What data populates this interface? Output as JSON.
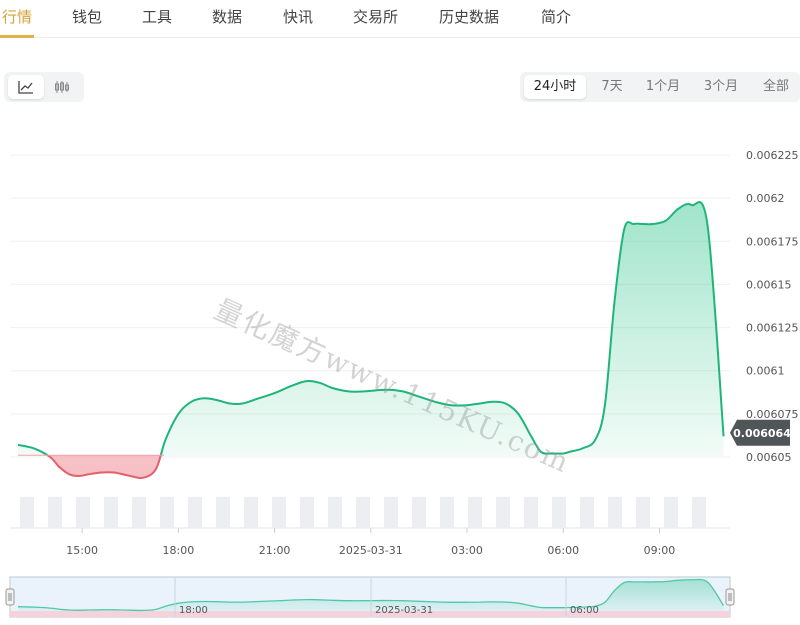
{
  "nav": {
    "tabs": [
      "行情",
      "钱包",
      "工具",
      "数据",
      "快讯",
      "交易所",
      "历史数据",
      "简介"
    ],
    "active_index": 0,
    "active_color": "#d8a23a"
  },
  "view_modes": {
    "items": [
      {
        "icon": "line-chart-icon",
        "active": true
      },
      {
        "icon": "candlestick-icon",
        "active": false
      }
    ]
  },
  "time_ranges": {
    "items": [
      "24小时",
      "7天",
      "1个月",
      "3个月",
      "全部"
    ],
    "active_index": 0
  },
  "watermark": "量化魔方www.115KU.com",
  "chart_data": {
    "type": "area",
    "x_ticks": [
      "15:00",
      "18:00",
      "21:00",
      "2025-03-31",
      "03:00",
      "06:00",
      "09:00"
    ],
    "y_ticks": [
      "0.006225",
      "0.0062",
      "0.006175",
      "0.00615",
      "0.006125",
      "0.0061",
      "0.006075",
      "0.00605"
    ],
    "ylim": [
      0.00605,
      0.006225
    ],
    "baseline": 0.006051,
    "current_price": 0.006064,
    "current_label": "0.006064",
    "x_unit": "hours",
    "x_range": [
      12.75,
      35.2
    ],
    "series": [
      {
        "x": [
          13.0,
          13.5,
          14.0,
          14.3,
          14.6,
          14.9,
          15.2,
          15.6,
          16.0,
          16.5,
          16.9,
          17.3,
          17.6,
          18.0,
          18.4,
          18.8,
          19.2,
          19.6,
          20.0,
          20.5,
          21.0,
          21.5,
          22.0,
          22.4,
          22.8,
          23.3,
          23.8,
          24.5,
          25.0,
          25.5,
          26.0,
          26.5,
          27.0,
          27.4,
          27.8,
          28.2,
          28.6,
          29.0,
          29.3,
          29.6,
          29.8,
          30.0,
          30.2,
          30.6,
          31.0,
          31.3,
          31.6,
          31.9,
          32.2,
          32.5,
          32.8,
          33.2,
          33.6,
          34.0,
          34.5,
          35.0
        ],
        "y": [
          0.006057,
          0.006055,
          0.00605,
          0.006044,
          0.00604,
          0.006039,
          0.00604,
          0.006041,
          0.006041,
          0.006039,
          0.006038,
          0.006043,
          0.00606,
          0.006075,
          0.006082,
          0.006084,
          0.006083,
          0.006081,
          0.006081,
          0.006084,
          0.006087,
          0.006091,
          0.006094,
          0.006093,
          0.00609,
          0.006088,
          0.006088,
          0.006089,
          0.006088,
          0.006085,
          0.006082,
          0.00608,
          0.00608,
          0.006081,
          0.006082,
          0.006081,
          0.006075,
          0.006062,
          0.006053,
          0.006052,
          0.006052,
          0.006052,
          0.006053,
          0.006055,
          0.00606,
          0.00608,
          0.00614,
          0.006182,
          0.006185,
          0.006185,
          0.006185,
          0.006187,
          0.006194,
          0.006196,
          0.006184,
          0.006062
        ]
      }
    ],
    "volume": [
      0.6,
      0.6,
      0.6,
      0.6,
      0.6,
      0.6,
      0.6,
      0.6,
      0.6,
      0.6,
      0.6,
      0.6,
      0.6,
      0.6,
      0.6,
      0.6,
      0.6,
      0.6,
      0.6,
      0.6,
      0.6,
      0.6,
      0.6,
      0.6,
      0.6
    ],
    "up_color": "#1fb57a",
    "down_color": "#e0606c",
    "navigator": {
      "x_ticks": [
        "18:00",
        "2025-03-31",
        "06:00"
      ]
    }
  }
}
